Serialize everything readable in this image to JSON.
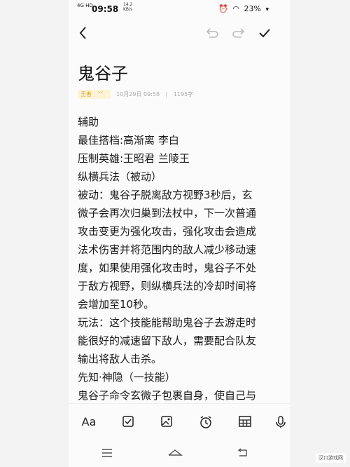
{
  "status": {
    "network": "4G HD",
    "time": "09:58",
    "speed_top": "14.2",
    "speed_bottom": "KB/s",
    "battery": "23%"
  },
  "note": {
    "title": "鬼谷子",
    "folder": "王者",
    "date": "10月29日 09:58",
    "word_count": "1195字",
    "lines": [
      "辅助",
      "最佳搭档:高渐离 李白",
      "压制英雄:王昭君 兰陵王",
      "纵横兵法（被动）",
      "被动：鬼谷子脱离敌方视野3秒后，玄",
      "微子会再次归巢到法杖中，下一次普通",
      "攻击变更为强化攻击，强化攻击会造成",
      "法术伤害并将范围内的敌人减少移动速",
      "度，如果使用强化攻击时，鬼谷子不处",
      "于敌方视野，则纵横兵法的冷却时间将",
      "会增加至10秒。",
      "玩法：这个技能能帮助鬼谷子去游走时",
      "能很好的减速留下敌人，需要配合队友",
      "输出将敌人击杀。",
      "先知·神隐（一技能）",
      "鬼谷子命令玄微子包裹自身，使自己与"
    ]
  },
  "bottom_toolbar": {
    "text_format_label": "Aa"
  },
  "watermark": "汉口游戏网"
}
